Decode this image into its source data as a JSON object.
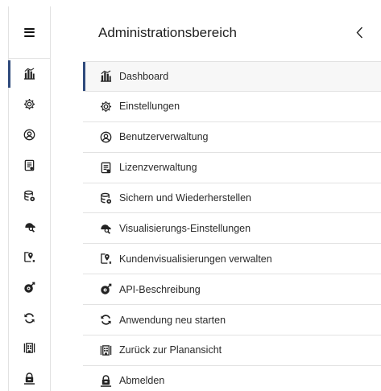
{
  "header": {
    "title": "Administrationsbereich",
    "back_icon": "chevron-left-icon"
  },
  "rail": {
    "menu_icon": "hamburger-icon"
  },
  "menu": {
    "items": [
      {
        "label": "Dashboard",
        "icon": "dashboard-icon",
        "active": true
      },
      {
        "label": "Einstellungen",
        "icon": "gear-icon",
        "active": false
      },
      {
        "label": "Benutzerverwaltung",
        "icon": "user-icon",
        "active": false
      },
      {
        "label": "Lizenzverwaltung",
        "icon": "license-icon",
        "active": false
      },
      {
        "label": "Sichern und Wiederherstellen",
        "icon": "backup-icon",
        "active": false
      },
      {
        "label": "Visualisierungs-Einstellungen",
        "icon": "visualization-icon",
        "active": false
      },
      {
        "label": "Kundenvisualisierungen verwalten",
        "icon": "customer-visualization-icon",
        "active": false
      },
      {
        "label": "API-Beschreibung",
        "icon": "api-icon",
        "active": false
      },
      {
        "label": "Anwendung neu starten",
        "icon": "restart-icon",
        "active": false
      },
      {
        "label": "Zurück zur Planansicht",
        "icon": "plan-view-icon",
        "active": false
      },
      {
        "label": "Abmelden",
        "icon": "logout-icon",
        "active": false
      }
    ]
  },
  "colors": {
    "accent": "#2f4a7c",
    "divider": "#e2e2e2",
    "active_bg": "#f7f7f7"
  }
}
